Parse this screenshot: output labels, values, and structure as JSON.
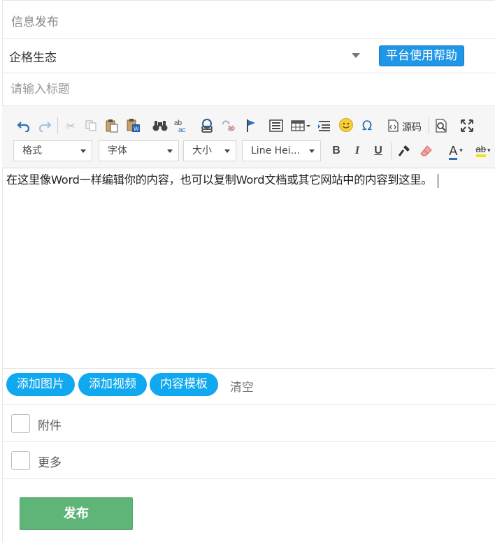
{
  "header": {
    "section_title": "信息发布"
  },
  "category": {
    "selected": "企格生态",
    "help_button": "平台使用帮助"
  },
  "title_input": {
    "placeholder": "请输入标题",
    "value": ""
  },
  "toolbar": {
    "source_label": "源码",
    "format_combo": "格式",
    "font_combo": "字体",
    "size_combo": "大小",
    "lineheight_combo": "Line Hei...",
    "bold": "B",
    "italic": "I",
    "underline": "U",
    "font_color": "A",
    "bg_color": "ab",
    "icons": [
      "undo-icon",
      "redo-icon",
      "cut-icon",
      "copy-icon",
      "paste-icon",
      "paste-word-icon",
      "find-icon",
      "spellcheck-icon",
      "link-icon",
      "unlink-icon",
      "anchor-icon",
      "template-icon",
      "table-icon",
      "list-icon",
      "smiley-icon",
      "omega-icon",
      "source-icon",
      "preview-icon",
      "maximize-icon",
      "format-painter-icon",
      "eraser-icon"
    ]
  },
  "editor": {
    "content": "在这里像Word一样编辑你的内容，也可以复制Word文档或其它网站中的内容到这里。"
  },
  "actions": {
    "add_image": "添加图片",
    "add_video": "添加视频",
    "content_template": "内容模板",
    "clear": "清空"
  },
  "options": {
    "attachment_label": "附件",
    "more_label": "更多"
  },
  "submit": {
    "publish_label": "发布"
  },
  "colors": {
    "help_button_bg": "#1f96e6",
    "pill_bg": "#10a8ee",
    "publish_bg": "#5fb578",
    "toolbar_bg": "#f6f6f6"
  }
}
